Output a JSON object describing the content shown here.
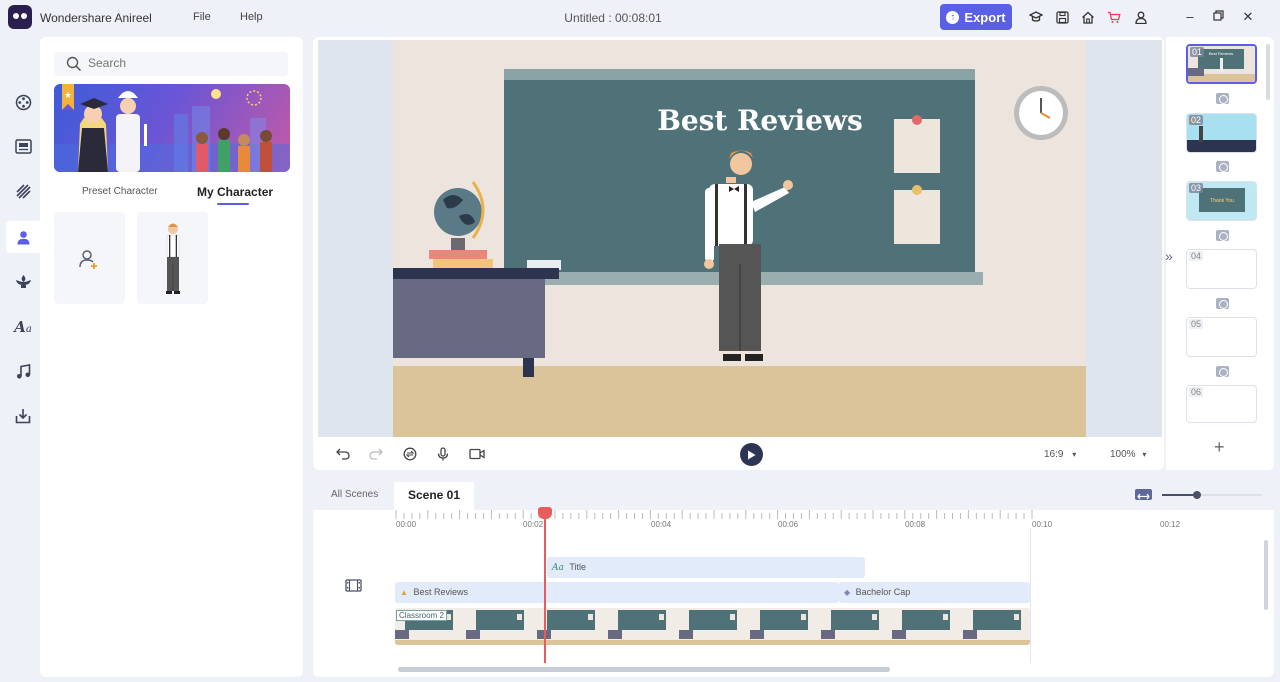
{
  "app": {
    "name": "Wondershare Anireel",
    "menu": [
      "File",
      "Help"
    ],
    "doc_title": "Untitled : 00:08:01",
    "export_label": "Export"
  },
  "left_panel": {
    "search_placeholder": "Search",
    "tabs": [
      "Preset Character",
      "My Character"
    ],
    "active_tab": "My Character"
  },
  "preview": {
    "board_title": "Best Reviews",
    "aspect_ratio": "16:9",
    "zoom": "100%"
  },
  "scene_strip": {
    "scenes": [
      "01",
      "02",
      "03",
      "04",
      "05",
      "06"
    ],
    "active": "01"
  },
  "timeline": {
    "tabs": [
      "All Scenes",
      "Scene 01"
    ],
    "ticks": [
      "00:00",
      "00:02",
      "00:04",
      "00:06",
      "00:08",
      "00:10",
      "00:12"
    ],
    "tracks": {
      "title": "Title",
      "text": "Best Reviews",
      "prop": "Bachelor Cap",
      "background": "Classroom 2"
    },
    "zoom_level": 0.35
  },
  "colors": {
    "accent": "#5b5fe6",
    "board": "#4f7278",
    "playhead": "#e85c5c"
  }
}
